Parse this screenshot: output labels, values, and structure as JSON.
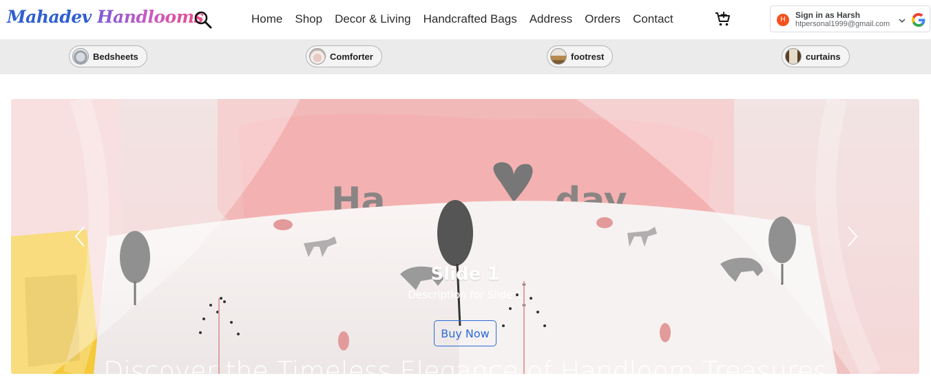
{
  "brand": {
    "word1": "Mahadev",
    "word2": "Handlooms"
  },
  "header": {
    "search_icon": "search-icon",
    "cart_icon": "cart-icon",
    "nav": [
      {
        "label": "Home"
      },
      {
        "label": "Shop"
      },
      {
        "label": "Decor & Living"
      },
      {
        "label": "Handcrafted Bags"
      },
      {
        "label": "Address"
      },
      {
        "label": "Orders"
      },
      {
        "label": "Contact"
      }
    ]
  },
  "signin": {
    "avatar_letter": "H",
    "label": "Sign in as Harsh",
    "email": "htpersonal1999@gmail.com",
    "avatar_color": "#f4511e"
  },
  "categories": [
    {
      "label": "Bedsheets"
    },
    {
      "label": "Comforter"
    },
    {
      "label": "footrest"
    },
    {
      "label": "curtains"
    }
  ],
  "carousel": {
    "slide_title": "Slide 1",
    "slide_description": "Description for Slide 1",
    "button_label": "Buy Now",
    "tagline": "Discover the Timeless Elegance of Handloom Treasures",
    "pillow_text_left": "Ha",
    "pillow_text_right": "day",
    "accent_color": "#2a6ad8"
  }
}
